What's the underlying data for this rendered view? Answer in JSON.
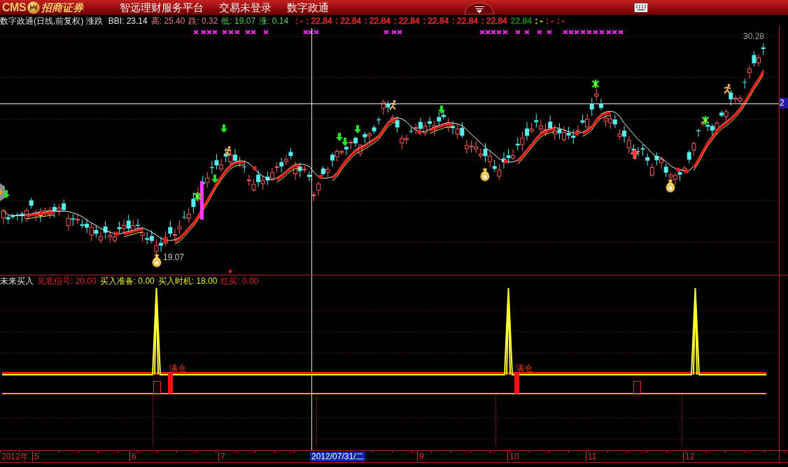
{
  "title_bar": {
    "logo": {
      "mark": "CMS",
      "name": "招商证券"
    },
    "menu": [
      "智远理财服务平台",
      "交易未登录",
      "数字政通"
    ],
    "toolbar_toggle": {
      "expanded": false
    }
  },
  "price_panel": {
    "title": "数字政通(日线,前复权) 涨跌",
    "readouts": [
      {
        "text": "BBI: 23.14",
        "color": "#e8e8e8"
      },
      {
        "text": "高: 25.40",
        "color": "#e07878"
      },
      {
        "text": "跌: 0.32",
        "color": "#e07878"
      },
      {
        "text": "低: 19.07",
        "color": "#58c858"
      },
      {
        "text": "涨: 0.14",
        "color": "#58c858"
      }
    ],
    "signals": [
      {
        "text": ": -",
        "color": "#e02828"
      },
      {
        "text": ": 22.84",
        "color": "#e02828"
      },
      {
        "text": ": 22.84",
        "color": "#e02828"
      },
      {
        "text": ": 22.84",
        "color": "#e02828"
      },
      {
        "text": ": 22.84",
        "color": "#e02828"
      },
      {
        "text": ": 22.84",
        "color": "#e02828"
      },
      {
        "text": ": 22.84",
        "color": "#e02828"
      },
      {
        "text": ": 22.84",
        "color": "#e02828"
      },
      {
        "text": "22.84",
        "color": "#1e7a1e"
      },
      {
        "text": ": -",
        "color": "#e0e020"
      },
      {
        "text": ": -",
        "color": "#e02828"
      },
      {
        "text": ": -",
        "color": "#e02828"
      }
    ],
    "high_label": "30.28",
    "low_label": "19.07",
    "cursor_price": "2"
  },
  "indicator_panel": {
    "title": "未来买入",
    "readouts": [
      {
        "text": "见底信号: 20.00",
        "color": "#e02828"
      },
      {
        "text": "买入准备: 0.00",
        "color": "#e8e830"
      },
      {
        "text": "买入时机: 18.00",
        "color": "#e8e830"
      },
      {
        "text": "红买: 0.00",
        "color": "#e02828"
      }
    ],
    "position_labels": [
      "满仓",
      "满仓"
    ]
  },
  "time_axis": {
    "labels": [
      {
        "text": "2012年",
        "kind": "year"
      },
      {
        "text": "5",
        "kind": "month"
      },
      {
        "text": "6",
        "kind": "month"
      },
      {
        "text": "7",
        "kind": "month"
      },
      {
        "text": "2012/07/31/二",
        "kind": "cursor"
      },
      {
        "text": "9",
        "kind": "month"
      },
      {
        "text": "10",
        "kind": "month"
      },
      {
        "text": "11",
        "kind": "month"
      },
      {
        "text": "12",
        "kind": "month"
      }
    ]
  }
}
